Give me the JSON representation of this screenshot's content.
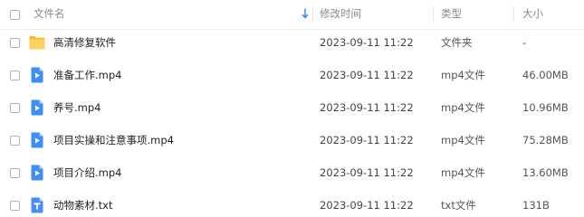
{
  "header": {
    "name": "文件名",
    "modified": "修改时间",
    "type": "类型",
    "size": "大小"
  },
  "files": [
    {
      "name": "高清修复软件",
      "modified": "2023-09-11 11:22",
      "type": "文件夹",
      "size": "-",
      "icon": "folder-icon"
    },
    {
      "name": "准备工作.mp4",
      "modified": "2023-09-11 11:22",
      "type": "mp4文件",
      "size": "46.00MB",
      "icon": "video-file-icon"
    },
    {
      "name": "养号.mp4",
      "modified": "2023-09-11 11:22",
      "type": "mp4文件",
      "size": "10.96MB",
      "icon": "video-file-icon"
    },
    {
      "name": "项目实操和注意事项.mp4",
      "modified": "2023-09-11 11:22",
      "type": "mp4文件",
      "size": "75.28MB",
      "icon": "video-file-icon"
    },
    {
      "name": "项目介绍.mp4",
      "modified": "2023-09-11 11:22",
      "type": "mp4文件",
      "size": "13.60MB",
      "icon": "video-file-icon"
    },
    {
      "name": "动物素材.txt",
      "modified": "2023-09-11 11:22",
      "type": "txt文件",
      "size": "131B",
      "icon": "text-file-icon"
    }
  ],
  "colors": {
    "folder": "#f6c343",
    "video": "#3d8ef5",
    "text": "#4a8cf7"
  }
}
